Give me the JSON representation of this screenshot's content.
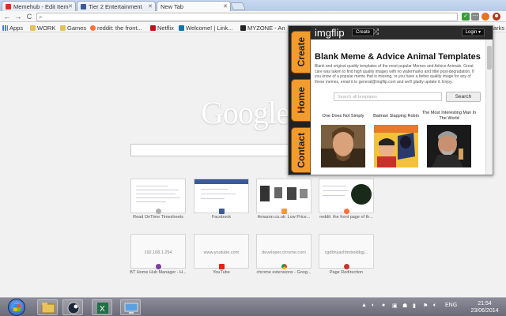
{
  "tabs": [
    {
      "label": "Memehub - Edit Item",
      "color": "#d93025"
    },
    {
      "label": "Tier 2 Entertainment",
      "color": "#3b5998"
    },
    {
      "label": "New Tab",
      "color": ""
    }
  ],
  "bookmarks": [
    {
      "label": "Apps",
      "icon": "apps-grid-icon"
    },
    {
      "label": "WORK",
      "icon": "folder-icon"
    },
    {
      "label": "Games",
      "icon": "folder-icon"
    },
    {
      "label": "reddit: the front...",
      "icon": "reddit-icon"
    },
    {
      "label": "Netflix",
      "icon": "netflix-icon"
    },
    {
      "label": "Welcome! | Link...",
      "icon": "linkedin-icon"
    },
    {
      "label": "MYZONE - An",
      "icon": "myzone-icon"
    },
    {
      "label": "arks",
      "icon": "other-bookmarks-icon"
    }
  ],
  "ntp": {
    "logo": "Google",
    "thumbs_row1": [
      {
        "label": "Read OnTime Timesheets"
      },
      {
        "label": "Facebook"
      },
      {
        "label": "Amazon.co.uk: Low Price..."
      },
      {
        "label": "reddit: the front page of th..."
      }
    ],
    "thumbs_row2": [
      {
        "label": "BT Home Hub Manager - H...",
        "inner": "192.168.1.254"
      },
      {
        "label": "YouTube",
        "inner": "www.youtube.com"
      },
      {
        "label": "chrome extensions - Goog...",
        "inner": "developer.chrome.com"
      },
      {
        "label": "Page Redirection",
        "inner": "cgdbhyazhhnboldkgj..."
      }
    ]
  },
  "popup": {
    "brand": "imgflip",
    "create_label": "Create",
    "login_label": "Login ▾",
    "side_tabs": [
      "Create",
      "Home",
      "Contact"
    ],
    "title": "Blank Meme & Advice Animal Templates",
    "description": "Blank and original quality templates of the most popular Memes and Advice Animals. Great care was taken to find high quality images with no watermarks and little post-degradation. If you know of a popular meme that is missing, or you have a better quality image for any of these memes, email it to general@imgflip.com and we'll gladly update it. Enjoy.",
    "search_placeholder": "Search all templates",
    "search_button": "Search",
    "memes": [
      {
        "title": "One Does Not Simply"
      },
      {
        "title": "Batman Slapping Robin"
      },
      {
        "title": "The Most Interesting Man In The World"
      }
    ]
  },
  "taskbar": {
    "language": "ENG",
    "time": "21:54",
    "date": "23/06/2014"
  },
  "colors": {
    "tab_strip": "#c8d8f0",
    "imgflip_orange": "#f29b2e",
    "imgflip_dark": "#2b2b2b",
    "taskbar": "#7a7a88"
  }
}
